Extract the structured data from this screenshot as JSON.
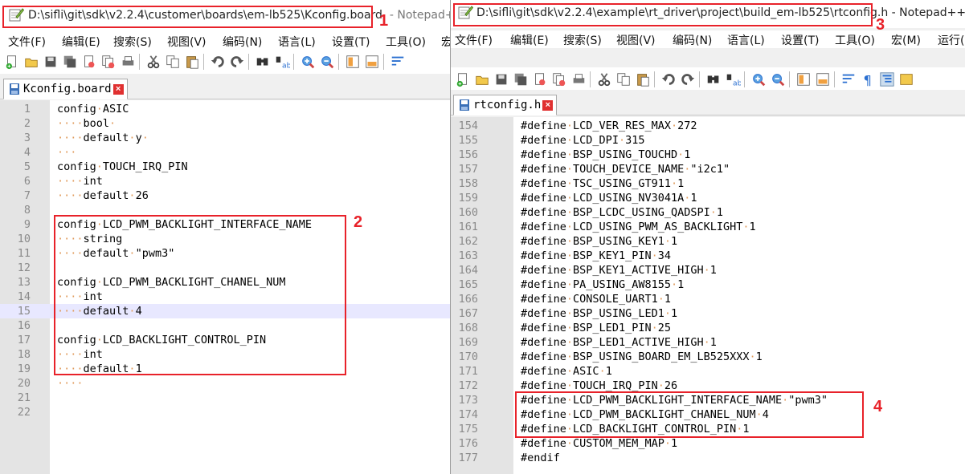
{
  "left_window": {
    "title": "D:\\sifli\\git\\sdk\\v2.2.4\\customer\\boards\\em-lb525\\Kconfig.board",
    "title_suffix": "- Notepad++",
    "menu": [
      "文件(F)",
      "编辑(E)",
      "搜索(S)",
      "视图(V)",
      "编码(N)",
      "语言(L)",
      "设置(T)",
      "工具(O)",
      "宏"
    ],
    "tab_label": "Kconfig.board",
    "current_line": 15,
    "lines": [
      {
        "num": "1",
        "text": "config·ASIC"
      },
      {
        "num": "2",
        "text": "····bool·"
      },
      {
        "num": "3",
        "text": "····default·y·"
      },
      {
        "num": "4",
        "text": "···"
      },
      {
        "num": "5",
        "text": "config·TOUCH_IRQ_PIN"
      },
      {
        "num": "6",
        "text": "····int"
      },
      {
        "num": "7",
        "text": "····default·26"
      },
      {
        "num": "8",
        "text": ""
      },
      {
        "num": "9",
        "text": "config·LCD_PWM_BACKLIGHT_INTERFACE_NAME"
      },
      {
        "num": "10",
        "text": "····string"
      },
      {
        "num": "11",
        "text": "····default·\"pwm3\""
      },
      {
        "num": "12",
        "text": ""
      },
      {
        "num": "13",
        "text": "config·LCD_PWM_BACKLIGHT_CHANEL_NUM"
      },
      {
        "num": "14",
        "text": "····int"
      },
      {
        "num": "15",
        "text": "····default·4"
      },
      {
        "num": "16",
        "text": ""
      },
      {
        "num": "17",
        "text": "config·LCD_BACKLIGHT_CONTROL_PIN"
      },
      {
        "num": "18",
        "text": "····int"
      },
      {
        "num": "19",
        "text": "····default·1"
      },
      {
        "num": "20",
        "text": "····"
      },
      {
        "num": "21",
        "text": ""
      },
      {
        "num": "22",
        "text": ""
      }
    ]
  },
  "right_window": {
    "title": "D:\\sifli\\git\\sdk\\v2.2.4\\example\\rt_driver\\project\\build_em-lb525\\rtconfig.h",
    "title_suffix": " - Notepad++",
    "menu": [
      "文件(F)",
      "编辑(E)",
      "搜索(S)",
      "视图(V)",
      "编码(N)",
      "语言(L)",
      "设置(T)",
      "工具(O)",
      "宏(M)",
      "运行("
    ],
    "tab_label": "rtconfig.h",
    "lines": [
      {
        "num": "154",
        "text": "#define·LCD_VER_RES_MAX·272"
      },
      {
        "num": "155",
        "text": "#define·LCD_DPI·315"
      },
      {
        "num": "156",
        "text": "#define·BSP_USING_TOUCHD·1"
      },
      {
        "num": "157",
        "text": "#define·TOUCH_DEVICE_NAME·\"i2c1\""
      },
      {
        "num": "158",
        "text": "#define·TSC_USING_GT911·1"
      },
      {
        "num": "159",
        "text": "#define·LCD_USING_NV3041A·1"
      },
      {
        "num": "160",
        "text": "#define·BSP_LCDC_USING_QADSPI·1"
      },
      {
        "num": "161",
        "text": "#define·LCD_USING_PWM_AS_BACKLIGHT·1"
      },
      {
        "num": "162",
        "text": "#define·BSP_USING_KEY1·1"
      },
      {
        "num": "163",
        "text": "#define·BSP_KEY1_PIN·34"
      },
      {
        "num": "164",
        "text": "#define·BSP_KEY1_ACTIVE_HIGH·1"
      },
      {
        "num": "165",
        "text": "#define·PA_USING_AW8155·1"
      },
      {
        "num": "166",
        "text": "#define·CONSOLE_UART1·1"
      },
      {
        "num": "167",
        "text": "#define·BSP_USING_LED1·1"
      },
      {
        "num": "168",
        "text": "#define·BSP_LED1_PIN·25"
      },
      {
        "num": "169",
        "text": "#define·BSP_LED1_ACTIVE_HIGH·1"
      },
      {
        "num": "170",
        "text": "#define·BSP_USING_BOARD_EM_LB525XXX·1"
      },
      {
        "num": "171",
        "text": "#define·ASIC·1"
      },
      {
        "num": "172",
        "text": "#define·TOUCH_IRQ_PIN·26"
      },
      {
        "num": "173",
        "text": "#define·LCD_PWM_BACKLIGHT_INTERFACE_NAME·\"pwm3\""
      },
      {
        "num": "174",
        "text": "#define·LCD_PWM_BACKLIGHT_CHANEL_NUM·4"
      },
      {
        "num": "175",
        "text": "#define·LCD_BACKLIGHT_CONTROL_PIN·1"
      },
      {
        "num": "176",
        "text": "#define·CUSTOM_MEM_MAP·1"
      },
      {
        "num": "177",
        "text": "#endif"
      }
    ]
  },
  "annotations": {
    "a1": "1",
    "a2": "2",
    "a3": "3",
    "a4": "4"
  },
  "colors": {
    "annotation_red": "#e8222a",
    "whitespace_dot": "#e09a5a",
    "current_line": "#e8e8ff",
    "gutter": "#e4e4e4"
  },
  "toolbar_icons": [
    "new-file-icon",
    "open-file-icon",
    "save-icon",
    "save-all-icon",
    "close-icon",
    "close-all-icon",
    "print-icon",
    "cut-icon",
    "copy-icon",
    "paste-icon",
    "undo-icon",
    "redo-icon",
    "find-icon",
    "replace-icon",
    "zoom-in-icon",
    "zoom-out-icon",
    "sync-vertical-icon",
    "sync-horizontal-icon",
    "word-wrap-icon",
    "show-all-chars-icon",
    "indent-guide-icon",
    "doc-map-icon"
  ]
}
